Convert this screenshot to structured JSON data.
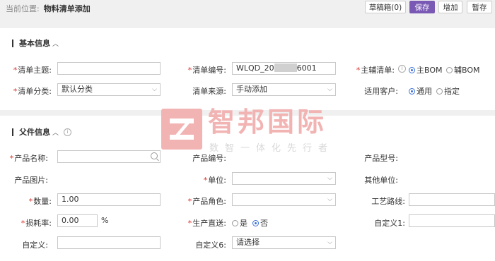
{
  "breadcrumb": {
    "prefix": "当前位置:",
    "current": "物料清单添加"
  },
  "toolbar": {
    "draft": "草稿箱(0)",
    "save": "保存",
    "add": "增加",
    "hold": "暂存"
  },
  "basic": {
    "title": "基本信息",
    "subject_label": "清单主题:",
    "subject_value": "",
    "code_label": "清单编号:",
    "code_prefix": "WLQD_20",
    "code_suffix": "6001",
    "main_aux_label": "主辅清单:",
    "main_option": "主BOM",
    "aux_option": "辅BOM",
    "category_label": "清单分类:",
    "category_value": "默认分类",
    "source_label": "清单来源:",
    "source_value": "手动添加",
    "customer_label": "适用客户:",
    "customer_general": "通用",
    "customer_specific": "指定"
  },
  "parent": {
    "title": "父件信息",
    "product_name_label": "产品名称:",
    "product_code_label": "产品编号:",
    "product_model_label": "产品型号:",
    "product_image_label": "产品图片:",
    "unit_label": "单位:",
    "other_unit_label": "其他单位:",
    "quantity_label": "数量:",
    "quantity_value": "1.00",
    "role_label": "产品角色:",
    "route_label": "工艺路线:",
    "loss_label": "损耗率:",
    "loss_value": "0.00",
    "loss_unit": "%",
    "direct_label": "生产直送:",
    "direct_yes": "是",
    "direct_no": "否",
    "custom1_label": "自定义1:",
    "custom_label": "自定义:",
    "custom6_label": "自定义6:",
    "custom6_value": "请选择"
  },
  "watermark": {
    "title": "智邦国际",
    "subtitle": "数智一体化先行者"
  }
}
